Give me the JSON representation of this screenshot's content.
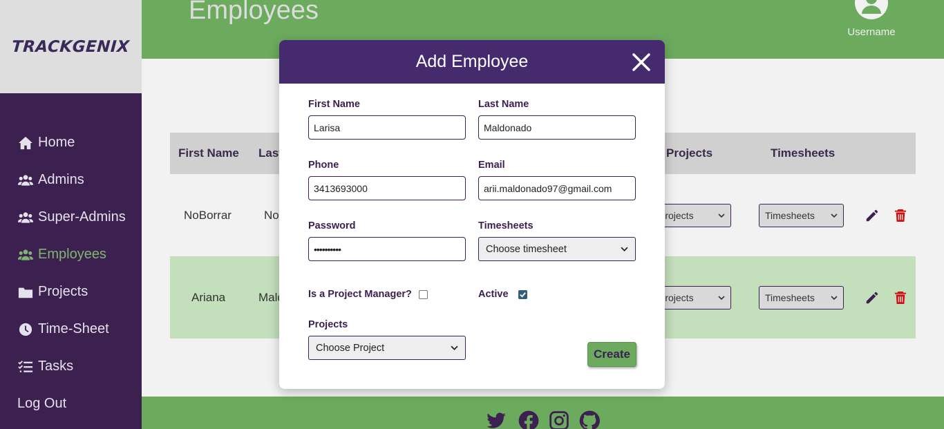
{
  "app": {
    "logo": "TRACKGENIX"
  },
  "sidebar": {
    "items": [
      {
        "label": "Home",
        "icon": "home-icon",
        "active": false
      },
      {
        "label": "Admins",
        "icon": "users-icon",
        "active": false
      },
      {
        "label": "Super-Admins",
        "icon": "users-icon",
        "active": false
      },
      {
        "label": "Employees",
        "icon": "users-icon",
        "active": true
      },
      {
        "label": "Projects",
        "icon": "folder-icon",
        "active": false
      },
      {
        "label": "Time-Sheet",
        "icon": "clock-icon",
        "active": false
      },
      {
        "label": "Tasks",
        "icon": "tasks-icon",
        "active": false
      },
      {
        "label": "Log Out",
        "icon": "",
        "active": false
      }
    ],
    "active_color": "#7fb571"
  },
  "header": {
    "title": "Employees",
    "username": "Username"
  },
  "table": {
    "headers": {
      "first_name": "First Name",
      "last_name": "Last Name",
      "projects": "Projects",
      "timesheets": "Timesheets"
    },
    "rows": [
      {
        "first_name": "NoBorrar",
        "last_name": "NoBorrar",
        "projects": "Projects",
        "timesheets": "Timesheets"
      },
      {
        "first_name": "Ariana",
        "last_name": "Maldonado",
        "projects": "Projects",
        "timesheets": "Timesheets"
      }
    ]
  },
  "modal": {
    "title": "Add Employee",
    "fields": {
      "first_name": {
        "label": "First Name",
        "value": "Larisa"
      },
      "last_name": {
        "label": "Last Name",
        "value": "Maldonado"
      },
      "phone": {
        "label": "Phone",
        "value": "3413693000"
      },
      "email": {
        "label": "Email",
        "value": "arii.maldonado97@gmail.com"
      },
      "password": {
        "label": "Password",
        "value": "••••••••••"
      },
      "timesheets": {
        "label": "Timesheets",
        "selected": "Choose timesheet"
      },
      "is_pm": {
        "label": "Is a Project Manager?",
        "checked": false
      },
      "active": {
        "label": "Active",
        "checked": true
      },
      "projects": {
        "label": "Projects",
        "selected": "Choose Project"
      }
    },
    "create_label": "Create"
  },
  "footer": {
    "icons": [
      "twitter-icon",
      "facebook-icon",
      "instagram-icon",
      "github-icon"
    ]
  },
  "colors": {
    "purple": "#3b2050",
    "modal_header": "#452a6e",
    "green": "#6cab5e",
    "alt_row": "#c3dfbc",
    "delete": "#cc1111"
  }
}
